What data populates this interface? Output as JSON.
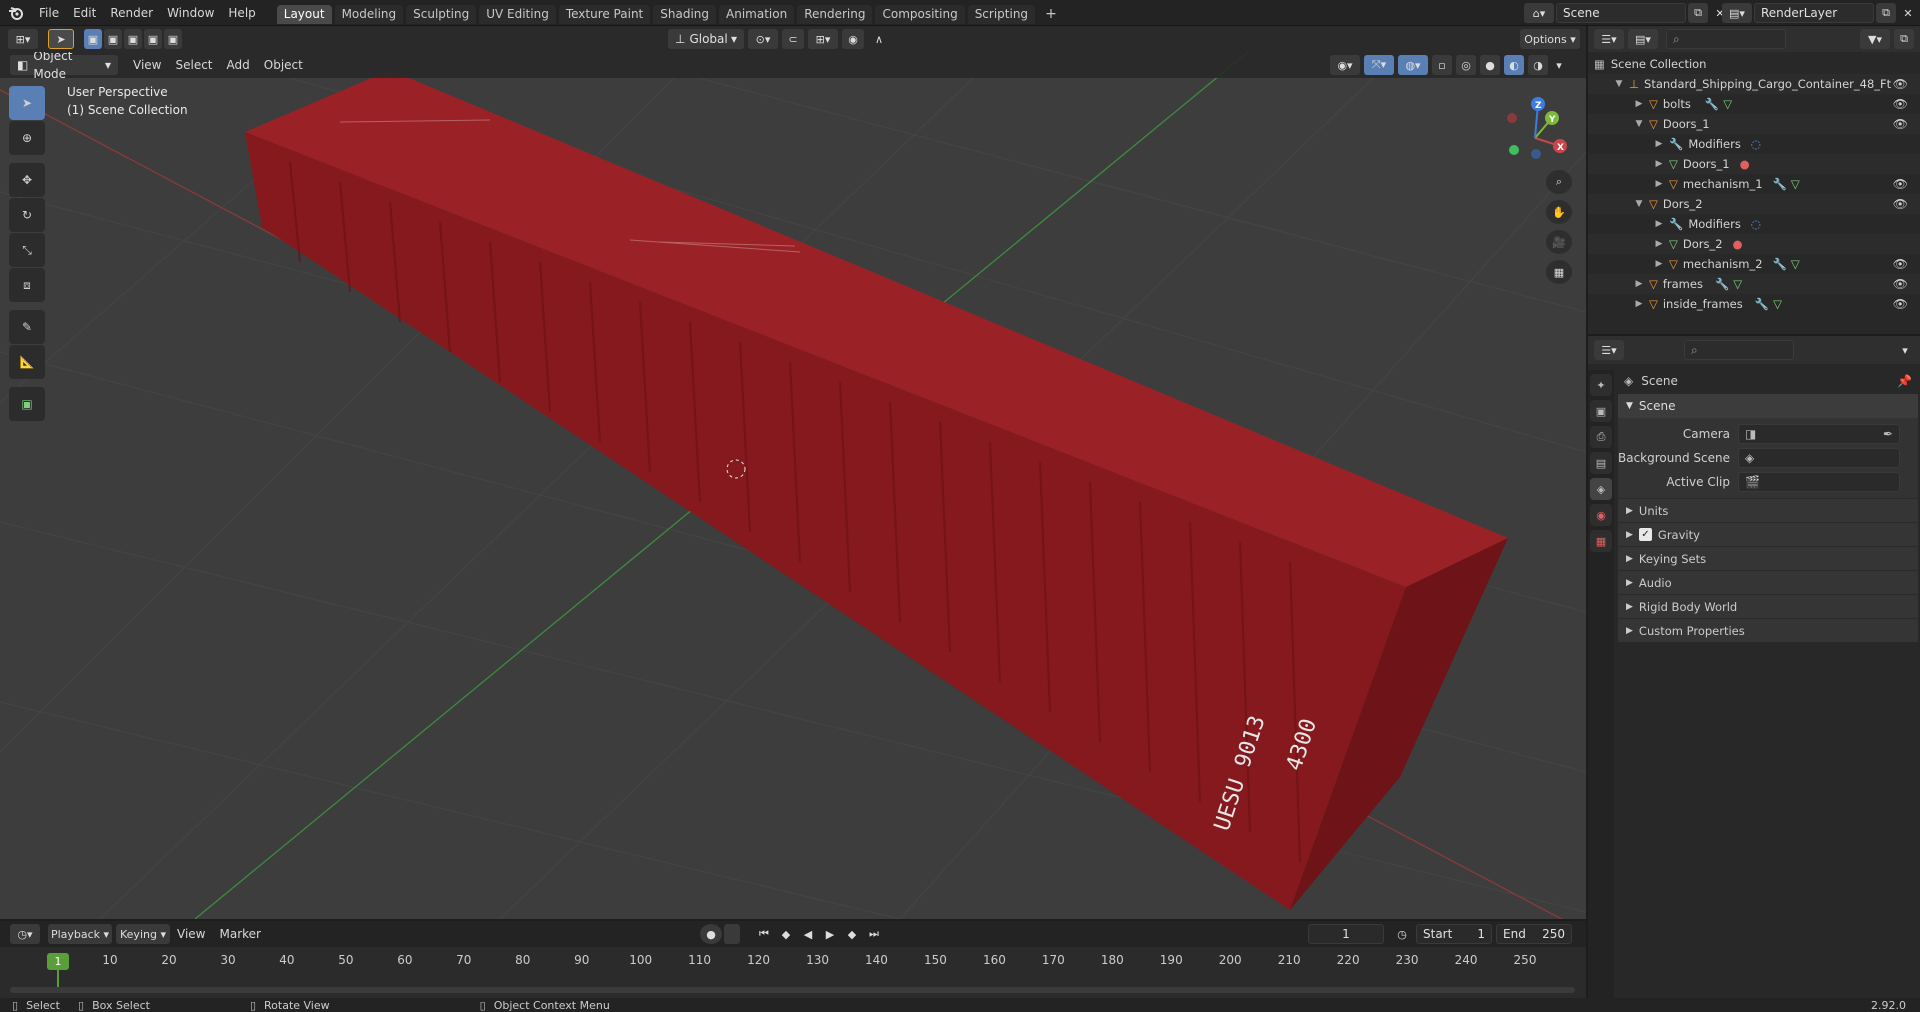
{
  "top_menu": {
    "items": [
      "File",
      "Edit",
      "Render",
      "Window",
      "Help"
    ]
  },
  "workspaces": {
    "tabs": [
      "Layout",
      "Modeling",
      "Sculpting",
      "UV Editing",
      "Texture Paint",
      "Shading",
      "Animation",
      "Rendering",
      "Compositing",
      "Scripting"
    ],
    "active": "Layout",
    "add_label": "+"
  },
  "scene_selector": {
    "scene": "Scene",
    "render_layer": "RenderLayer"
  },
  "viewport_header": {
    "mode": "Object Mode",
    "menus": [
      "View",
      "Select",
      "Add",
      "Object"
    ],
    "transform_orientation": "Global",
    "options_label": "Options"
  },
  "viewport": {
    "overlay_line1": "User Perspective",
    "overlay_line2": "(1) Scene Collection",
    "gizmo": {
      "x": "X",
      "y": "Y",
      "z": "Z"
    },
    "container_text_1": "4300",
    "container_text_2": "UESU 9013"
  },
  "outliner": {
    "root": "Scene Collection",
    "items": [
      {
        "label": "Standard_Shipping_Cargo_Container_48_Ft",
        "indent": 1,
        "expanded": true
      },
      {
        "label": "bolts",
        "indent": 2,
        "expanded": false
      },
      {
        "label": "Doors_1",
        "indent": 2,
        "expanded": true
      },
      {
        "label": "Modifiers",
        "indent": 3,
        "expanded": false
      },
      {
        "label": "Doors_1",
        "indent": 3,
        "expanded": false
      },
      {
        "label": "mechanism_1",
        "indent": 3,
        "expanded": false
      },
      {
        "label": "Dors_2",
        "indent": 2,
        "expanded": true
      },
      {
        "label": "Modifiers",
        "indent": 3,
        "expanded": false
      },
      {
        "label": "Dors_2",
        "indent": 3,
        "expanded": false
      },
      {
        "label": "mechanism_2",
        "indent": 3,
        "expanded": false
      },
      {
        "label": "frames",
        "indent": 2,
        "expanded": false
      },
      {
        "label": "inside_frames",
        "indent": 2,
        "expanded": false
      }
    ]
  },
  "properties": {
    "context_title": "Scene",
    "panel_title": "Scene",
    "fields": [
      {
        "label": "Camera"
      },
      {
        "label": "Background Scene"
      },
      {
        "label": "Active Clip"
      }
    ],
    "subpanels": [
      "Units",
      "Gravity",
      "Keying Sets",
      "Audio",
      "Rigid Body World",
      "Custom Properties"
    ],
    "gravity_checked": true
  },
  "timeline": {
    "menus": [
      "Playback",
      "Keying",
      "View",
      "Marker"
    ],
    "current_frame": "1",
    "start_label": "Start",
    "start": "1",
    "end_label": "End",
    "end": "250",
    "ruler": [
      "10",
      "20",
      "30",
      "40",
      "50",
      "60",
      "70",
      "80",
      "90",
      "100",
      "110",
      "120",
      "130",
      "140",
      "150",
      "160",
      "170",
      "180",
      "190",
      "200",
      "210",
      "220",
      "230",
      "240",
      "250"
    ],
    "playhead": "1"
  },
  "statusbar": {
    "select": "Select",
    "box_select": "Box Select",
    "rotate_view": "Rotate View",
    "context_menu": "Object Context Menu",
    "version": "2.92.0"
  },
  "colors": {
    "accent": "#5a7fb4",
    "container": "#8e1b20",
    "grid_green": "#4c9e4c",
    "grid_red": "#a33b3b"
  }
}
